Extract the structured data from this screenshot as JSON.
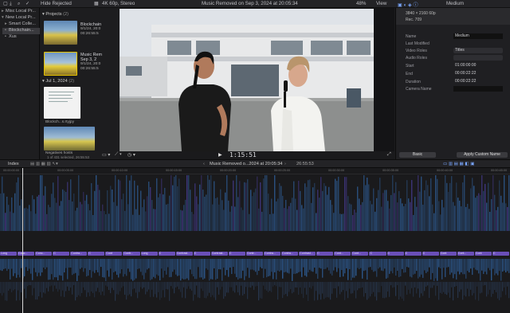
{
  "topbar": {
    "hide_rejected": "Hide Rejected",
    "format": "4K 60p, Stereo",
    "title": "Music Removed on Sep 3, 2024 at 20:05:34",
    "zoom": "48%",
    "view": "View",
    "inspector_title": "Medium"
  },
  "library": {
    "items": [
      {
        "label": "Misc Local Pr..."
      },
      {
        "label": "New Local Pr..."
      },
      {
        "label": "Smart Colle..."
      },
      {
        "label": "Blockchain..."
      },
      {
        "label": "Xus"
      }
    ]
  },
  "browser": {
    "projects_label": "Projects",
    "projects_count": "(2)",
    "date_group": "Jul 1, 2024",
    "date_count": "(2)",
    "clip1": {
      "name": "Blockchain",
      "date": "9/1/24, 20:0",
      "time": "00:26:55:5"
    },
    "clip2": {
      "name": "Music Rem",
      "date": "Sep 3, 2",
      "time": "9/1/24, 20:0",
      "dur": "00:26:55:5"
    },
    "clip3": {
      "name": "Blockch...s.rtyjpy"
    },
    "clip4": {
      "name": "Negatives hosts"
    },
    "selection": "1 of 431 selected, 26:55:53"
  },
  "viewer": {
    "timecode": "1:15:51"
  },
  "inspector": {
    "resolution": "3840 × 2160 60p",
    "codec": "Rec. 709",
    "rows": [
      {
        "label": "Name",
        "value": "Medium"
      },
      {
        "label": "Last Modified",
        "value": ""
      },
      {
        "label": "Video Roles",
        "value": "Titles"
      },
      {
        "label": "Audio Roles",
        "value": ""
      },
      {
        "label": "Start",
        "value": "01:00:00:00"
      },
      {
        "label": "End",
        "value": "00:00:22:22"
      },
      {
        "label": "Duration",
        "value": "00:00:22:22"
      },
      {
        "label": "Camera Name",
        "value": ""
      }
    ],
    "basic_button": "Basic",
    "apply_button": "Apply Custom Name"
  },
  "timeline": {
    "index_label": "Index",
    "project_title": "Music Removed o...2024 at 20:05:34",
    "duration": "26:55:53",
    "ruler": [
      "00:00:00:00",
      "00:00:05:00",
      "00:00:10:00",
      "00:00:15:00",
      "00:00:20:00",
      "00:00:25:00",
      "00:00:30:00",
      "00:00:35:00",
      "00:00:40:00",
      "00:00:45:00"
    ],
    "clip_labels": [
      "Long",
      "Conc...",
      "Conc...",
      "C",
      "Contra...",
      "C",
      "Cont",
      "Contr...",
      "Long",
      "C",
      "Contrast...",
      "C",
      "Contrast...",
      "C",
      "Contr...",
      "Contra...",
      "Contra...",
      "Contrast...",
      "C",
      "Cont...",
      "Cont...",
      "C",
      "C",
      "C",
      "C",
      "Cont",
      "Cont...",
      "Cont",
      "C"
    ],
    "colors": {
      "accent": "#6a4fb8",
      "audio": "#2f5f9a",
      "video": "#3f3a8f"
    }
  }
}
